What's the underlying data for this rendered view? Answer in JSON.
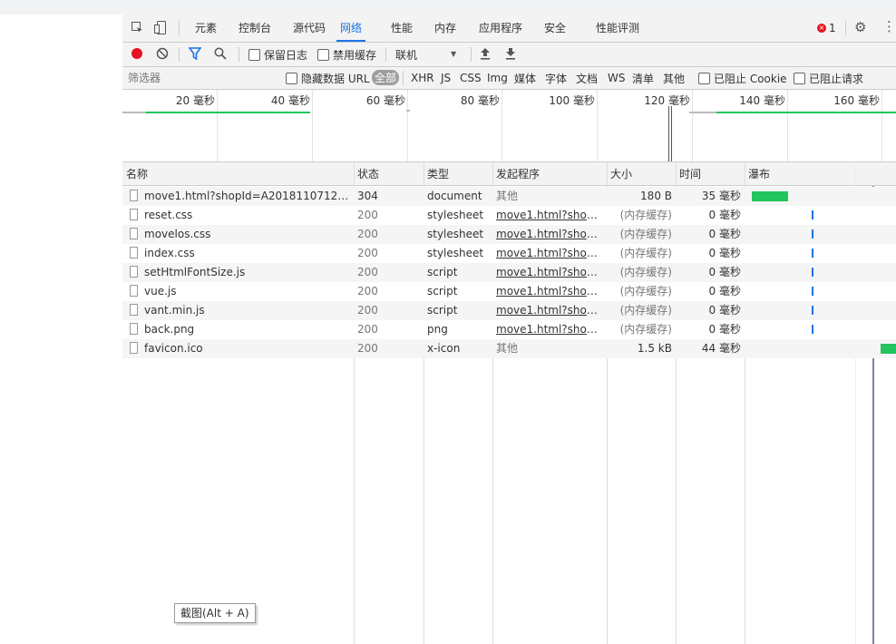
{
  "tabs": [
    {
      "label": "元素"
    },
    {
      "label": "控制台"
    },
    {
      "label": "源代码"
    },
    {
      "label": "网络"
    },
    {
      "label": "性能"
    },
    {
      "label": "内存"
    },
    {
      "label": "应用程序"
    },
    {
      "label": "安全"
    },
    {
      "label": "性能评测"
    }
  ],
  "error_count": "1",
  "toolbar": {
    "preserve_log": "保留日志",
    "disable_cache": "禁用缓存",
    "throttle": "联机"
  },
  "filter": {
    "placeholder": "筛选器",
    "hide_data_url": "隐藏数据 URL",
    "all": "全部",
    "types": [
      "XHR",
      "JS",
      "CSS",
      "Img",
      "媒体",
      "字体",
      "文档",
      "WS",
      "清单",
      "其他"
    ],
    "blocked_cookies": "已阻止 Cookie",
    "blocked_requests": "已阻止请求"
  },
  "overview_ticks": [
    "20 毫秒",
    "40 毫秒",
    "60 毫秒",
    "80 毫秒",
    "100 毫秒",
    "120 毫秒",
    "140 毫秒",
    "160 毫秒"
  ],
  "columns": {
    "name": "名称",
    "status": "状态",
    "type": "类型",
    "initiator": "发起程序",
    "size": "大小",
    "time": "时间",
    "waterfall": "瀑布"
  },
  "requests": [
    {
      "name": "move1.html?shopId=A201811071226026...",
      "status": "304",
      "type": "document",
      "initiator": "其他",
      "initiator_link": false,
      "size": "180 B",
      "time": "35 毫秒"
    },
    {
      "name": "reset.css",
      "status": "200",
      "type": "stylesheet",
      "initiator": "move1.html?shopId...",
      "initiator_link": true,
      "size": "(内存缓存)",
      "time": "0 毫秒"
    },
    {
      "name": "movelos.css",
      "status": "200",
      "type": "stylesheet",
      "initiator": "move1.html?shopId...",
      "initiator_link": true,
      "size": "(内存缓存)",
      "time": "0 毫秒"
    },
    {
      "name": "index.css",
      "status": "200",
      "type": "stylesheet",
      "initiator": "move1.html?shopId...",
      "initiator_link": true,
      "size": "(内存缓存)",
      "time": "0 毫秒"
    },
    {
      "name": "setHtmlFontSize.js",
      "status": "200",
      "type": "script",
      "initiator": "move1.html?shopId...",
      "initiator_link": true,
      "size": "(内存缓存)",
      "time": "0 毫秒"
    },
    {
      "name": "vue.js",
      "status": "200",
      "type": "script",
      "initiator": "move1.html?shopId...",
      "initiator_link": true,
      "size": "(内存缓存)",
      "time": "0 毫秒"
    },
    {
      "name": "vant.min.js",
      "status": "200",
      "type": "script",
      "initiator": "move1.html?shopId...",
      "initiator_link": true,
      "size": "(内存缓存)",
      "time": "0 毫秒"
    },
    {
      "name": "back.png",
      "status": "200",
      "type": "png",
      "initiator": "move1.html?shopId...",
      "initiator_link": true,
      "size": "(内存缓存)",
      "time": "0 毫秒"
    },
    {
      "name": "favicon.ico",
      "status": "200",
      "type": "x-icon",
      "initiator": "其他",
      "initiator_link": false,
      "size": "1.5 kB",
      "time": "44 毫秒"
    }
  ],
  "screenshot_tip": "截图(Alt + A)",
  "colors": {
    "accent": "#1a73e8",
    "waterfall": "#22c55e",
    "record": "#e81123"
  }
}
